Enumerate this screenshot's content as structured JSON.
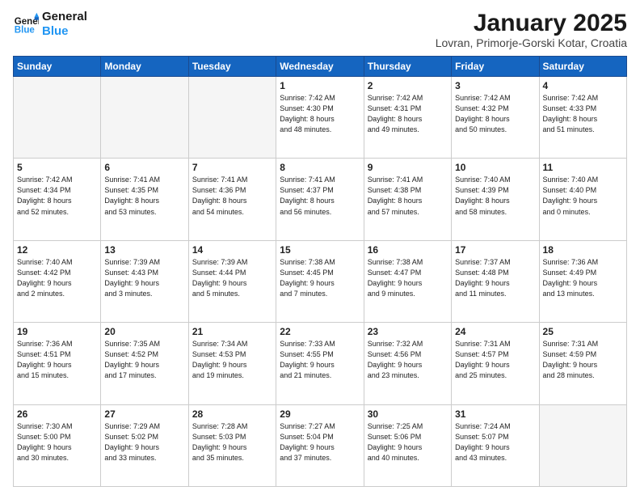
{
  "header": {
    "logo_line1": "General",
    "logo_line2": "Blue",
    "title": "January 2025",
    "subtitle": "Lovran, Primorje-Gorski Kotar, Croatia"
  },
  "weekdays": [
    "Sunday",
    "Monday",
    "Tuesday",
    "Wednesday",
    "Thursday",
    "Friday",
    "Saturday"
  ],
  "weeks": [
    [
      {
        "num": "",
        "info": ""
      },
      {
        "num": "",
        "info": ""
      },
      {
        "num": "",
        "info": ""
      },
      {
        "num": "1",
        "info": "Sunrise: 7:42 AM\nSunset: 4:30 PM\nDaylight: 8 hours\nand 48 minutes."
      },
      {
        "num": "2",
        "info": "Sunrise: 7:42 AM\nSunset: 4:31 PM\nDaylight: 8 hours\nand 49 minutes."
      },
      {
        "num": "3",
        "info": "Sunrise: 7:42 AM\nSunset: 4:32 PM\nDaylight: 8 hours\nand 50 minutes."
      },
      {
        "num": "4",
        "info": "Sunrise: 7:42 AM\nSunset: 4:33 PM\nDaylight: 8 hours\nand 51 minutes."
      }
    ],
    [
      {
        "num": "5",
        "info": "Sunrise: 7:42 AM\nSunset: 4:34 PM\nDaylight: 8 hours\nand 52 minutes."
      },
      {
        "num": "6",
        "info": "Sunrise: 7:41 AM\nSunset: 4:35 PM\nDaylight: 8 hours\nand 53 minutes."
      },
      {
        "num": "7",
        "info": "Sunrise: 7:41 AM\nSunset: 4:36 PM\nDaylight: 8 hours\nand 54 minutes."
      },
      {
        "num": "8",
        "info": "Sunrise: 7:41 AM\nSunset: 4:37 PM\nDaylight: 8 hours\nand 56 minutes."
      },
      {
        "num": "9",
        "info": "Sunrise: 7:41 AM\nSunset: 4:38 PM\nDaylight: 8 hours\nand 57 minutes."
      },
      {
        "num": "10",
        "info": "Sunrise: 7:40 AM\nSunset: 4:39 PM\nDaylight: 8 hours\nand 58 minutes."
      },
      {
        "num": "11",
        "info": "Sunrise: 7:40 AM\nSunset: 4:40 PM\nDaylight: 9 hours\nand 0 minutes."
      }
    ],
    [
      {
        "num": "12",
        "info": "Sunrise: 7:40 AM\nSunset: 4:42 PM\nDaylight: 9 hours\nand 2 minutes."
      },
      {
        "num": "13",
        "info": "Sunrise: 7:39 AM\nSunset: 4:43 PM\nDaylight: 9 hours\nand 3 minutes."
      },
      {
        "num": "14",
        "info": "Sunrise: 7:39 AM\nSunset: 4:44 PM\nDaylight: 9 hours\nand 5 minutes."
      },
      {
        "num": "15",
        "info": "Sunrise: 7:38 AM\nSunset: 4:45 PM\nDaylight: 9 hours\nand 7 minutes."
      },
      {
        "num": "16",
        "info": "Sunrise: 7:38 AM\nSunset: 4:47 PM\nDaylight: 9 hours\nand 9 minutes."
      },
      {
        "num": "17",
        "info": "Sunrise: 7:37 AM\nSunset: 4:48 PM\nDaylight: 9 hours\nand 11 minutes."
      },
      {
        "num": "18",
        "info": "Sunrise: 7:36 AM\nSunset: 4:49 PM\nDaylight: 9 hours\nand 13 minutes."
      }
    ],
    [
      {
        "num": "19",
        "info": "Sunrise: 7:36 AM\nSunset: 4:51 PM\nDaylight: 9 hours\nand 15 minutes."
      },
      {
        "num": "20",
        "info": "Sunrise: 7:35 AM\nSunset: 4:52 PM\nDaylight: 9 hours\nand 17 minutes."
      },
      {
        "num": "21",
        "info": "Sunrise: 7:34 AM\nSunset: 4:53 PM\nDaylight: 9 hours\nand 19 minutes."
      },
      {
        "num": "22",
        "info": "Sunrise: 7:33 AM\nSunset: 4:55 PM\nDaylight: 9 hours\nand 21 minutes."
      },
      {
        "num": "23",
        "info": "Sunrise: 7:32 AM\nSunset: 4:56 PM\nDaylight: 9 hours\nand 23 minutes."
      },
      {
        "num": "24",
        "info": "Sunrise: 7:31 AM\nSunset: 4:57 PM\nDaylight: 9 hours\nand 25 minutes."
      },
      {
        "num": "25",
        "info": "Sunrise: 7:31 AM\nSunset: 4:59 PM\nDaylight: 9 hours\nand 28 minutes."
      }
    ],
    [
      {
        "num": "26",
        "info": "Sunrise: 7:30 AM\nSunset: 5:00 PM\nDaylight: 9 hours\nand 30 minutes."
      },
      {
        "num": "27",
        "info": "Sunrise: 7:29 AM\nSunset: 5:02 PM\nDaylight: 9 hours\nand 33 minutes."
      },
      {
        "num": "28",
        "info": "Sunrise: 7:28 AM\nSunset: 5:03 PM\nDaylight: 9 hours\nand 35 minutes."
      },
      {
        "num": "29",
        "info": "Sunrise: 7:27 AM\nSunset: 5:04 PM\nDaylight: 9 hours\nand 37 minutes."
      },
      {
        "num": "30",
        "info": "Sunrise: 7:25 AM\nSunset: 5:06 PM\nDaylight: 9 hours\nand 40 minutes."
      },
      {
        "num": "31",
        "info": "Sunrise: 7:24 AM\nSunset: 5:07 PM\nDaylight: 9 hours\nand 43 minutes."
      },
      {
        "num": "",
        "info": ""
      }
    ]
  ]
}
